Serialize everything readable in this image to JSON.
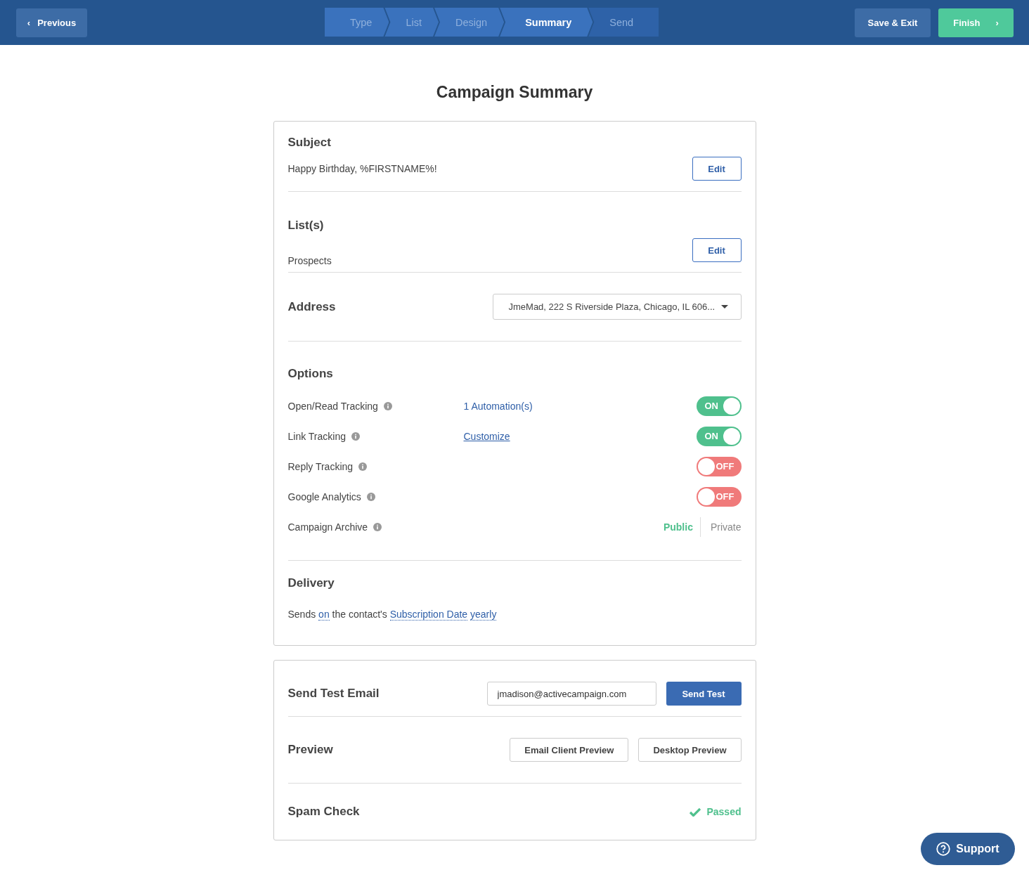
{
  "header": {
    "previous": "Previous",
    "previous_icon": "‹",
    "steps": [
      {
        "label": "Type",
        "selected": false,
        "completed": true
      },
      {
        "label": "List",
        "selected": false,
        "completed": true
      },
      {
        "label": "Design",
        "selected": false,
        "completed": true
      },
      {
        "label": "Summary",
        "selected": true,
        "completed": false
      },
      {
        "label": "Send",
        "selected": false,
        "completed": false
      }
    ],
    "save_exit": "Save & Exit",
    "finish": "Finish",
    "finish_icon": "›"
  },
  "title": "Campaign Summary",
  "summary": {
    "subject": {
      "heading": "Subject",
      "text": "Happy Birthday, %FIRSTNAME%!",
      "button": "Edit"
    },
    "lists": {
      "heading": "List(s)",
      "text": "Prospects",
      "button": "Edit"
    },
    "address": {
      "heading": "Address",
      "value": "JmeMad, 222 S Riverside Plaza, Chicago, IL 606..."
    },
    "options": {
      "heading": "Options",
      "rows": [
        {
          "kind": "toggle",
          "label": "Open/Read Tracking",
          "link": "1 Automation(s)",
          "link_underlined": false,
          "on": true,
          "state_label": "ON"
        },
        {
          "kind": "toggle",
          "label": "Link Tracking",
          "link": "Customize",
          "link_underlined": true,
          "on": true,
          "state_label": "ON"
        },
        {
          "kind": "toggle",
          "label": "Reply Tracking",
          "on": false,
          "state_label": "OFF"
        },
        {
          "kind": "toggle",
          "label": "Google Analytics",
          "on": false,
          "state_label": "OFF"
        },
        {
          "kind": "segmented",
          "label": "Campaign Archive",
          "choices": [
            {
              "label": "Public",
              "selected": true
            },
            {
              "label": "Private",
              "selected": false
            }
          ]
        }
      ]
    },
    "delivery": {
      "heading": "Delivery",
      "parts": [
        {
          "kind": "text",
          "text": "Sends"
        },
        {
          "kind": "link",
          "text": "on"
        },
        {
          "kind": "text",
          "text": "the contact's"
        },
        {
          "kind": "link",
          "text": "Subscription Date"
        },
        {
          "kind": "link",
          "text": "yearly"
        }
      ]
    }
  },
  "test": {
    "send_test": {
      "heading": "Send Test Email",
      "value": "jmadison@activecampaign.com",
      "button": "Send Test"
    },
    "preview": {
      "heading": "Preview",
      "buttons": [
        "Email Client Preview",
        "Desktop Preview"
      ]
    },
    "spam": {
      "heading": "Spam Check",
      "status": "Passed"
    }
  },
  "support": "Support"
}
